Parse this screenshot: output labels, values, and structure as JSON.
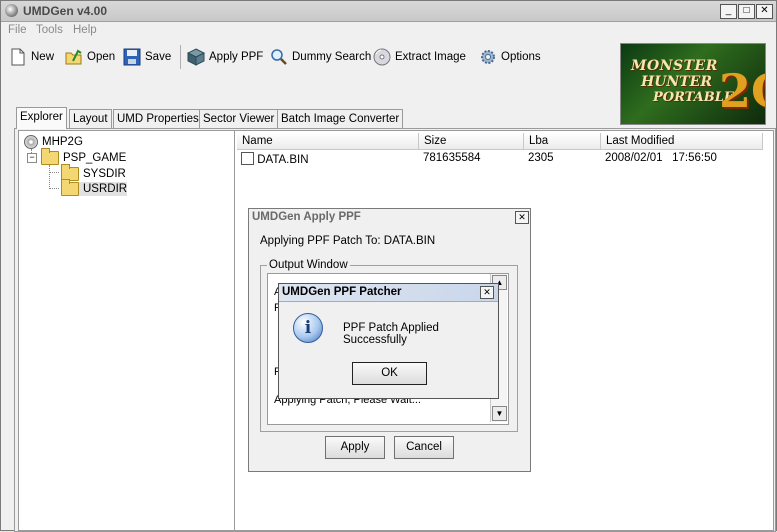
{
  "window": {
    "title": "UMDGen v4.00",
    "minimize": "_",
    "maximize": "□",
    "close": "✕"
  },
  "menu": [
    "File",
    "Tools",
    "Help"
  ],
  "toolbar": {
    "new": "New",
    "open": "Open",
    "save": "Save",
    "apply_ppf": "Apply PPF",
    "dummy_search": "Dummy Search",
    "extract_image": "Extract Image",
    "options": "Options"
  },
  "logo": {
    "line1": "MONSTER",
    "line2": "HUNTER",
    "line3": "PORTABLE",
    "mark": "2G"
  },
  "tabs": [
    "Explorer",
    "Layout",
    "UMD Properties",
    "Sector Viewer",
    "Batch Image Converter"
  ],
  "tree": {
    "root": "MHP2G",
    "game": "PSP_GAME",
    "sysdir": "SYSDIR",
    "usrdir": "USRDIR"
  },
  "list": {
    "headers": [
      "Name",
      "Size",
      "Lba",
      "Last Modified"
    ],
    "rows": [
      {
        "name": "DATA.BIN",
        "size": "781635584",
        "lba": "2305",
        "modified": "2008/02/01   17:56:50"
      }
    ]
  },
  "ppf_dialog": {
    "title": "UMDGen Apply PPF",
    "message": "Applying PPF Patch To: DATA.BIN",
    "group": "Output Window",
    "output_lines": [
      "A",
      "P",
      "I",
      "P",
      "Applying Patch, Please Wait..."
    ],
    "apply": "Apply",
    "cancel": "Cancel"
  },
  "patcher_dialog": {
    "title": "UMDGen PPF Patcher",
    "message": "PPF Patch Applied Successfully",
    "ok": "OK",
    "close": "✕",
    "info_glyph": "i"
  }
}
